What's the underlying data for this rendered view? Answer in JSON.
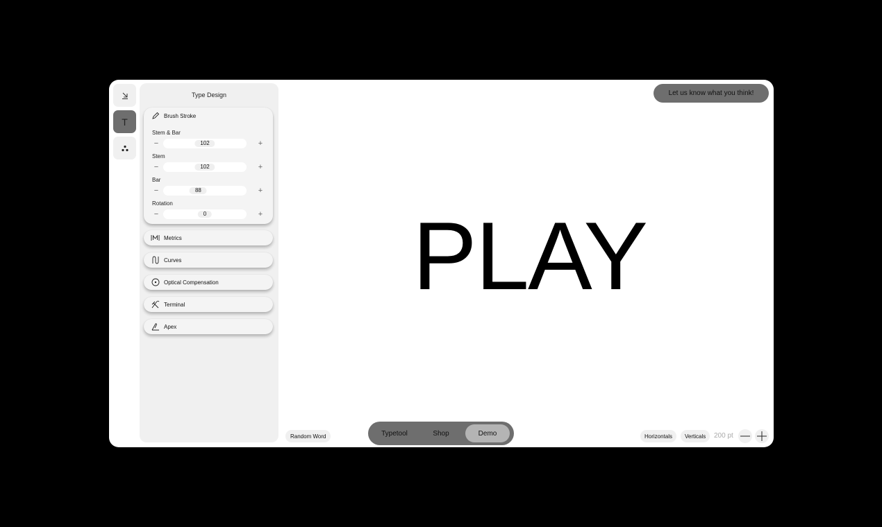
{
  "panel": {
    "title": "Type Design",
    "brush_stroke": {
      "label": "Brush Stroke",
      "params": [
        {
          "label": "Stem & Bar",
          "value": "102"
        },
        {
          "label": "Stem",
          "value": "102"
        },
        {
          "label": "Bar",
          "value": "88"
        },
        {
          "label": "Rotation",
          "value": "0"
        }
      ]
    },
    "sections": [
      {
        "label": "Metrics",
        "icon": "metrics-icon"
      },
      {
        "label": "Curves",
        "icon": "curves-icon"
      },
      {
        "label": "Optical Compensation",
        "icon": "optical-compensation-icon"
      },
      {
        "label": "Terminal",
        "icon": "terminal-icon"
      },
      {
        "label": "Apex",
        "icon": "apex-icon"
      }
    ]
  },
  "toolbar": {
    "tools": [
      {
        "name": "collapse-icon",
        "active": false
      },
      {
        "name": "text-tool-icon",
        "label": "T",
        "active": true
      },
      {
        "name": "dots-icon",
        "active": false
      }
    ]
  },
  "stage": {
    "word": "PLAY"
  },
  "feedback_label": "Let us know what you think!",
  "random_word_label": "Random Word",
  "nav": {
    "items": [
      {
        "label": "Typetool",
        "active": false
      },
      {
        "label": "Shop",
        "active": false
      },
      {
        "label": "Demo",
        "active": true
      }
    ]
  },
  "view": {
    "horizontals_label": "Horizontals",
    "verticals_label": "Verticals",
    "size_label": "200 pt"
  },
  "colors": {
    "background": "#000000",
    "surface": "#ffffff",
    "panel": "#f0f0f0",
    "accent_gray": "#6e6e6e"
  }
}
